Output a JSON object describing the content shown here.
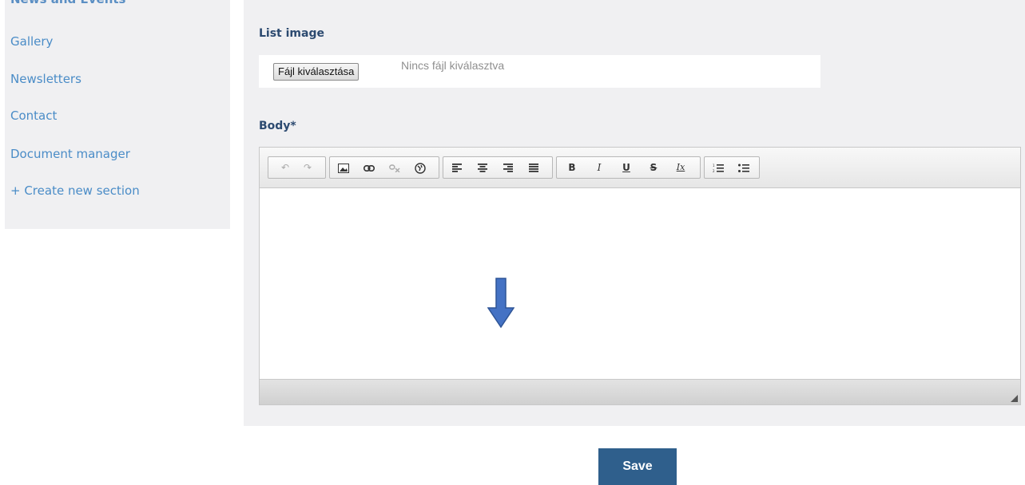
{
  "sidebar": {
    "cut_off_item": "News and Events",
    "items": [
      {
        "label": "Gallery"
      },
      {
        "label": "Newsletters"
      },
      {
        "label": "Contact"
      },
      {
        "label": "Document manager"
      },
      {
        "label": "+ Create new section"
      }
    ]
  },
  "form": {
    "list_image_label": "List image",
    "file_button_label": "Fájl kiválasztása",
    "file_status": "Nincs fájl kiválasztva",
    "body_label": "Body*"
  },
  "toolbar": {
    "undo": "↶",
    "redo": "↷",
    "bold": "B",
    "italic": "I",
    "underline": "U",
    "strike": "S",
    "remove_format": "Ix"
  },
  "colors": {
    "link": "#4a8cc7",
    "label": "#2c4a70",
    "save_button": "#2f5f8c",
    "arrow": "#4472c4"
  },
  "save_label": "Save"
}
